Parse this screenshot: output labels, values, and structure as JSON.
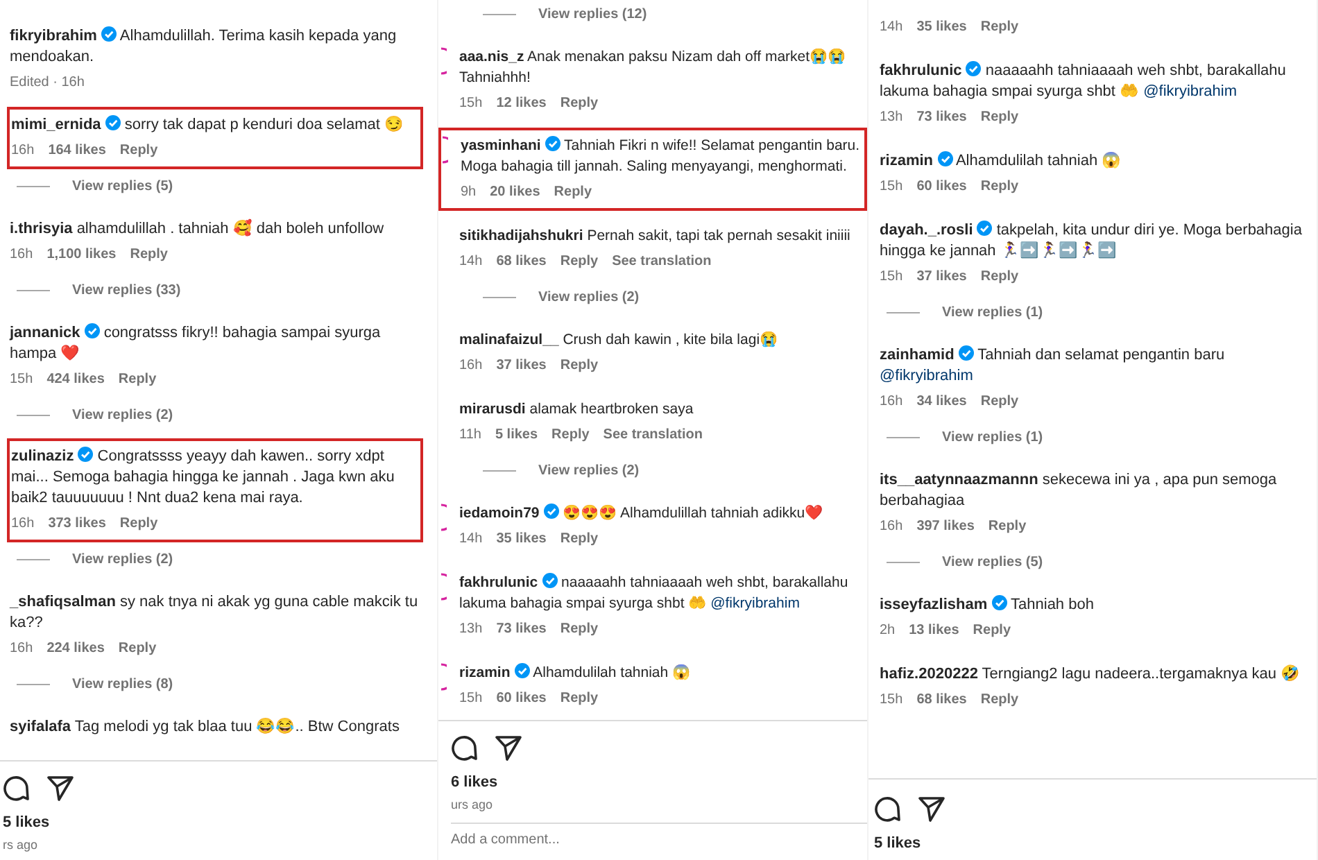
{
  "panels": [
    {
      "items": [
        {
          "kind": "comment",
          "user": "fikryibrahim",
          "verified": true,
          "text": "Alhamdulillah. Terima kasih kepada yang mendoakan.",
          "time": "Edited · 16h",
          "highlighted": false
        },
        {
          "kind": "comment",
          "user": "mimi_ernida",
          "verified": true,
          "text": "sorry tak dapat p kenduri doa selamat 😏",
          "time": "16h",
          "likes": "164 likes",
          "reply": "Reply",
          "highlighted": true
        },
        {
          "kind": "view_replies",
          "label": "View replies (5)"
        },
        {
          "kind": "comment",
          "user": "i.thrisyia",
          "verified": false,
          "text": "alhamdulillah . tahniah 🥰 dah boleh unfollow",
          "time": "16h",
          "likes": "1,100 likes",
          "reply": "Reply",
          "highlighted": false
        },
        {
          "kind": "view_replies",
          "label": "View replies (33)"
        },
        {
          "kind": "comment",
          "user": "jannanick",
          "verified": true,
          "text": "congratsss fikry!! bahagia sampai syurga hampa ❤️",
          "time": "15h",
          "likes": "424 likes",
          "reply": "Reply",
          "highlighted": false
        },
        {
          "kind": "view_replies",
          "label": "View replies (2)"
        },
        {
          "kind": "comment",
          "user": "zulinaziz",
          "verified": true,
          "text": "Congratssss yeayy dah kawen.. sorry xdpt mai... Semoga bahagia hingga ke jannah . Jaga kwn aku baik2 tauuuuuuu ! Nnt dua2 kena mai raya.",
          "time": "16h",
          "likes": "373 likes",
          "reply": "Reply",
          "highlighted": true
        },
        {
          "kind": "view_replies",
          "label": "View replies (2)"
        },
        {
          "kind": "comment",
          "user": "_shafiqsalman",
          "verified": false,
          "text": "sy nak tnya ni akak yg guna cable makcik tu ka??",
          "time": "16h",
          "likes": "224 likes",
          "reply": "Reply",
          "highlighted": false
        },
        {
          "kind": "view_replies",
          "label": "View replies (8)"
        },
        {
          "kind": "comment",
          "user": "syifalafa",
          "verified": false,
          "text": "Tag melodi yg tak blaa tuu 😂😂.. Btw Congrats",
          "highlighted": false
        }
      ],
      "footer": {
        "likes": "5 likes",
        "time_ago": "rs ago"
      }
    },
    {
      "items": [
        {
          "kind": "view_replies",
          "label": "View replies (12)"
        },
        {
          "kind": "comment",
          "user": "aaa.nis_z",
          "verified": false,
          "avatar": true,
          "text": "Anak menakan paksu Nizam dah off market😭😭 Tahniahhh!",
          "time": "15h",
          "likes": "12 likes",
          "reply": "Reply",
          "highlighted": false
        },
        {
          "kind": "comment",
          "user": "yasminhani",
          "verified": true,
          "avatar": true,
          "text": "Tahniah Fikri n wife!! Selamat pengantin baru. Moga bahagia till jannah. Saling menyayangi, menghormati.",
          "time": "9h",
          "likes": "20 likes",
          "reply": "Reply",
          "highlighted": true
        },
        {
          "kind": "comment",
          "user": "sitikhadijahshukri",
          "verified": false,
          "avatar": false,
          "text": "Pernah sakit, tapi tak pernah sesakit iniiii",
          "time": "14h",
          "likes": "68 likes",
          "reply": "Reply",
          "translation": "See translation",
          "highlighted": false
        },
        {
          "kind": "view_replies",
          "label": "View replies (2)"
        },
        {
          "kind": "comment",
          "user": "malinafaizul__",
          "verified": false,
          "avatar": false,
          "text": "Crush dah kawin , kite bila lagi😭",
          "time": "16h",
          "likes": "37 likes",
          "reply": "Reply",
          "highlighted": false
        },
        {
          "kind": "comment",
          "user": "mirarusdi",
          "verified": false,
          "avatar": false,
          "text": "alamak heartbroken saya",
          "time": "11h",
          "likes": "5 likes",
          "reply": "Reply",
          "translation": "See translation",
          "highlighted": false
        },
        {
          "kind": "view_replies",
          "label": "View replies (2)"
        },
        {
          "kind": "comment",
          "user": "iedamoin79",
          "verified": true,
          "avatar": true,
          "text": "😍😍😍 Alhamdulillah tahniah adikku❤️",
          "time": "14h",
          "likes": "35 likes",
          "reply": "Reply",
          "highlighted": false
        },
        {
          "kind": "comment",
          "user": "fakhrulunic",
          "verified": true,
          "avatar": true,
          "text": "naaaaahh tahniaaaah weh shbt, barakallahu lakuma bahagia smpai syurga shbt 🤲",
          "mention": "@fikryibrahim",
          "time": "13h",
          "likes": "73 likes",
          "reply": "Reply",
          "highlighted": false
        },
        {
          "kind": "comment",
          "user": "rizamin",
          "verified": true,
          "avatar": true,
          "text": "Alhamdulilah tahniah 😱",
          "time": "15h",
          "likes": "60 likes",
          "reply": "Reply",
          "highlighted": false
        }
      ],
      "footer": {
        "likes": "6 likes",
        "time_ago": "urs ago",
        "comment_placeholder": "Add a comment..."
      }
    },
    {
      "items": [
        {
          "kind": "comment",
          "time": "14h",
          "likes": "35 likes",
          "reply": "Reply",
          "highlighted": false
        },
        {
          "kind": "comment",
          "user": "fakhrulunic",
          "verified": true,
          "text": "naaaaahh tahniaaaah weh shbt, barakallahu lakuma bahagia smpai syurga shbt 🤲",
          "mention": "@fikryibrahim",
          "time": "13h",
          "likes": "73 likes",
          "reply": "Reply",
          "highlighted": false
        },
        {
          "kind": "comment",
          "user": "rizamin",
          "verified": true,
          "text": "Alhamdulilah tahniah 😱",
          "time": "15h",
          "likes": "60 likes",
          "reply": "Reply",
          "highlighted": false
        },
        {
          "kind": "comment",
          "user": "dayah._.rosli",
          "verified": true,
          "text": "takpelah, kita undur diri ye. Moga berbahagia hingga ke jannah 🏃‍♀️➡️🏃‍♀️➡️🏃‍♀️➡️",
          "time": "15h",
          "likes": "37 likes",
          "reply": "Reply",
          "highlighted": false
        },
        {
          "kind": "view_replies",
          "label": "View replies (1)"
        },
        {
          "kind": "comment",
          "user": "zainhamid",
          "verified": true,
          "text": "Tahniah dan selamat pengantin baru",
          "mention": "@fikryibrahim",
          "time": "16h",
          "likes": "34 likes",
          "reply": "Reply",
          "highlighted": false
        },
        {
          "kind": "view_replies",
          "label": "View replies (1)"
        },
        {
          "kind": "comment",
          "user": "its__aatynnaazmannn",
          "verified": false,
          "text": "sekecewa ini ya , apa pun semoga berbahagiaa",
          "time": "16h",
          "likes": "397 likes",
          "reply": "Reply",
          "highlighted": false
        },
        {
          "kind": "view_replies",
          "label": "View replies (5)"
        },
        {
          "kind": "comment",
          "user": "isseyfazlisham",
          "verified": true,
          "text": "Tahniah boh",
          "time": "2h",
          "likes": "13 likes",
          "reply": "Reply",
          "highlighted": false
        },
        {
          "kind": "comment",
          "user": "hafiz.2020222",
          "verified": false,
          "text": "Terngiang2 lagu nadeera..tergamaknya kau 🤣",
          "time": "15h",
          "likes": "68 likes",
          "reply": "Reply",
          "highlighted": false
        }
      ],
      "footer": {
        "likes": "5 likes"
      }
    }
  ]
}
